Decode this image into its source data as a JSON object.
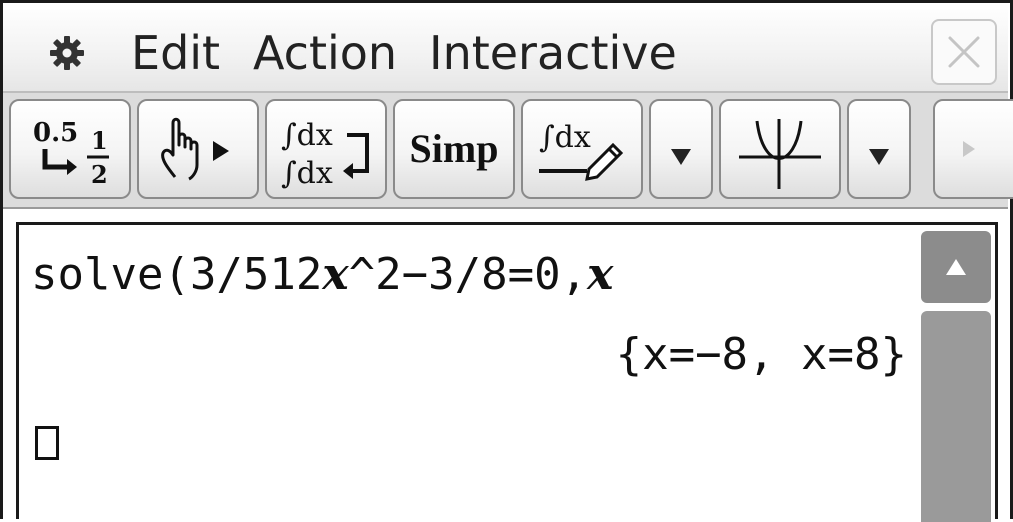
{
  "menubar": {
    "gear_icon": "gear-icon",
    "items": [
      "Edit",
      "Action",
      "Interactive"
    ],
    "close_icon": "close-icon"
  },
  "toolbar": {
    "buttons": [
      {
        "name": "decimal-fraction-toggle-button",
        "icon": "decimal-fraction-icon",
        "top": "0.5",
        "num": "1",
        "den": "2"
      },
      {
        "name": "drag-hand-button",
        "icon": "hand-pointer-icon"
      },
      {
        "name": "integral-input-mode-button",
        "icon": "integral-swap-icon",
        "top": "∫dx",
        "bottom": "∫dx"
      },
      {
        "name": "simplify-button",
        "label": "Simp"
      },
      {
        "name": "math-input-button",
        "icon": "integral-pencil-icon",
        "label": "∫dx"
      },
      {
        "name": "dropdown-button-1",
        "icon": "triangle-down-icon"
      },
      {
        "name": "graph-button",
        "icon": "parabola-graph-icon"
      },
      {
        "name": "dropdown-button-2",
        "icon": "triangle-down-icon"
      },
      {
        "name": "toolbar-scroll-right-button",
        "icon": "triangle-right-icon"
      }
    ]
  },
  "work": {
    "input": {
      "prefix": "solve(3/512",
      "var1": "x",
      "mid": "^2−3/8=0,",
      "var2": "x"
    },
    "output": "{x=−8, x=8}"
  }
}
